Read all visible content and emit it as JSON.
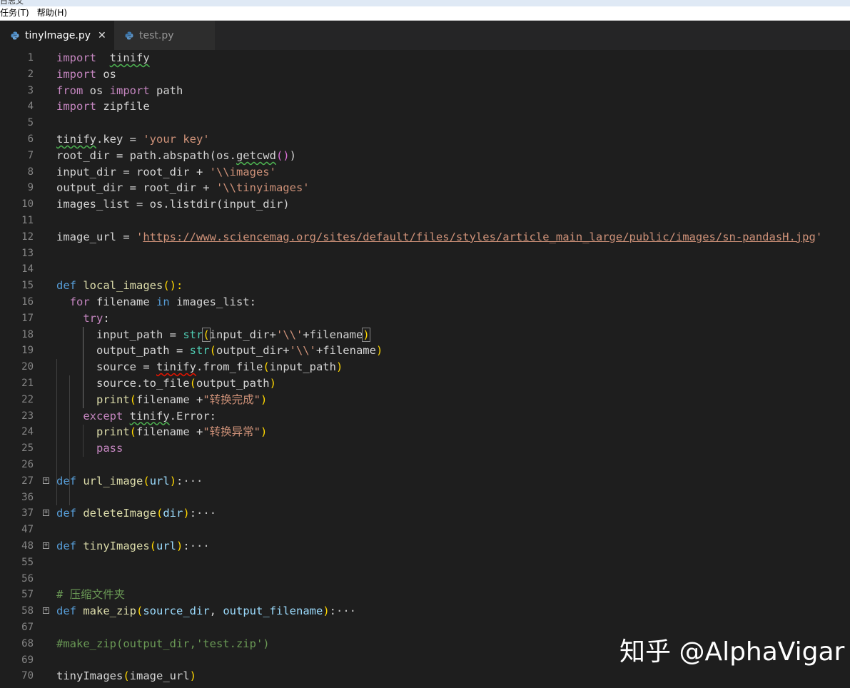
{
  "window": {
    "title_fragment": "日志文"
  },
  "menu": {
    "items": [
      "任务(T)",
      "帮助(H)"
    ]
  },
  "tabs": [
    {
      "label": "tinyImage.py",
      "active": true,
      "close": "✕"
    },
    {
      "label": "test.py",
      "active": false
    }
  ],
  "editor": {
    "lines": [
      {
        "n": "1",
        "tokens": [
          [
            "kw",
            "import"
          ],
          [
            "",
            "  "
          ],
          [
            "sq-green",
            "tinify"
          ]
        ]
      },
      {
        "n": "2",
        "tokens": [
          [
            "kw",
            "import"
          ],
          [
            "",
            " os"
          ]
        ]
      },
      {
        "n": "3",
        "tokens": [
          [
            "kw",
            "from"
          ],
          [
            "",
            " os "
          ],
          [
            "kw",
            "import"
          ],
          [
            "",
            " path"
          ]
        ]
      },
      {
        "n": "4",
        "tokens": [
          [
            "kw",
            "import"
          ],
          [
            "",
            " zipfile"
          ]
        ]
      },
      {
        "n": "5",
        "tokens": []
      },
      {
        "n": "6",
        "tokens": [
          [
            "sq-green",
            "tinify"
          ],
          [
            "",
            ".key = "
          ],
          [
            "str",
            "'your key'"
          ]
        ]
      },
      {
        "n": "7",
        "tokens": [
          [
            "",
            "root_dir = path.abspath(os."
          ],
          [
            "sq-green",
            "getcwd"
          ],
          [
            "br2",
            "()"
          ],
          [
            "",
            ")"
          ]
        ]
      },
      {
        "n": "8",
        "tokens": [
          [
            "",
            "input_dir = root_dir + "
          ],
          [
            "str",
            "'\\\\images'"
          ]
        ]
      },
      {
        "n": "9",
        "tokens": [
          [
            "",
            "output_dir = root_dir + "
          ],
          [
            "str",
            "'\\\\tinyimages'"
          ]
        ]
      },
      {
        "n": "10",
        "tokens": [
          [
            "",
            "images_list = os.listdir(input_dir)"
          ]
        ]
      },
      {
        "n": "11",
        "tokens": []
      },
      {
        "n": "12",
        "tokens": [
          [
            "",
            "image_url = "
          ],
          [
            "str",
            "'"
          ],
          [
            "str link",
            "https://www.sciencemag.org/sites/default/files/styles/article_main_large/public/images/sn-pandasH.jpg"
          ],
          [
            "str",
            "'"
          ]
        ]
      },
      {
        "n": "13",
        "tokens": []
      },
      {
        "n": "14",
        "tokens": []
      },
      {
        "n": "15",
        "tokens": [
          [
            "def",
            "def"
          ],
          [
            "",
            " "
          ],
          [
            "fn",
            "local_images"
          ],
          [
            "br",
            "():"
          ]
        ]
      },
      {
        "n": "16",
        "tokens": [
          [
            "",
            "  "
          ],
          [
            "kw",
            "for"
          ],
          [
            "",
            " filename "
          ],
          [
            "def",
            "in"
          ],
          [
            "",
            " images_list:"
          ]
        ]
      },
      {
        "n": "17",
        "tokens": [
          [
            "",
            "    "
          ],
          [
            "kw",
            "try"
          ],
          [
            "",
            ":"
          ]
        ]
      },
      {
        "n": "18",
        "tokens": [
          [
            "",
            "      input_path = "
          ],
          [
            "bi",
            "str"
          ],
          [
            "br bm",
            "("
          ],
          [
            "",
            "input_dir+"
          ],
          [
            "str",
            "'\\\\'"
          ],
          [
            "",
            "+filename"
          ],
          [
            "br bm",
            ")"
          ]
        ]
      },
      {
        "n": "19",
        "tokens": [
          [
            "",
            "      output_path = "
          ],
          [
            "bi",
            "str"
          ],
          [
            "br",
            "("
          ],
          [
            "",
            "output_dir+"
          ],
          [
            "str",
            "'\\\\'"
          ],
          [
            "",
            "+filename"
          ],
          [
            "br",
            ")"
          ]
        ]
      },
      {
        "n": "20",
        "tokens": [
          [
            "",
            "      source = "
          ],
          [
            "sq-red",
            "tinify"
          ],
          [
            "",
            ".from_file"
          ],
          [
            "br",
            "("
          ],
          [
            "",
            "input_path"
          ],
          [
            "br",
            ")"
          ]
        ]
      },
      {
        "n": "21",
        "tokens": [
          [
            "",
            "      source.to_file"
          ],
          [
            "br",
            "("
          ],
          [
            "",
            "output_path"
          ],
          [
            "br",
            ")"
          ]
        ]
      },
      {
        "n": "22",
        "tokens": [
          [
            "",
            "      "
          ],
          [
            "fn",
            "print"
          ],
          [
            "br",
            "("
          ],
          [
            "",
            "filename +"
          ],
          [
            "str",
            "\"转换完成\""
          ],
          [
            "br",
            ")"
          ]
        ]
      },
      {
        "n": "23",
        "tokens": [
          [
            "",
            "    "
          ],
          [
            "kw",
            "except"
          ],
          [
            "",
            " "
          ],
          [
            "sq-green",
            "tinify"
          ],
          [
            "",
            ".Error:"
          ]
        ]
      },
      {
        "n": "24",
        "tokens": [
          [
            "",
            "      "
          ],
          [
            "fn",
            "print"
          ],
          [
            "br",
            "("
          ],
          [
            "",
            "filename +"
          ],
          [
            "str",
            "\"转换异常\""
          ],
          [
            "br",
            ")"
          ]
        ]
      },
      {
        "n": "25",
        "tokens": [
          [
            "",
            "      "
          ],
          [
            "kw",
            "pass"
          ]
        ]
      },
      {
        "n": "26",
        "tokens": []
      },
      {
        "n": "27",
        "fold": true,
        "tokens": [
          [
            "def",
            "def"
          ],
          [
            "",
            " "
          ],
          [
            "fn",
            "url_image"
          ],
          [
            "br",
            "("
          ],
          [
            "pm",
            "url"
          ],
          [
            "br",
            ")"
          ],
          [
            "",
            ":"
          ],
          [
            "ell",
            "···"
          ]
        ]
      },
      {
        "n": "36",
        "tokens": []
      },
      {
        "n": "37",
        "fold": true,
        "tokens": [
          [
            "def",
            "def"
          ],
          [
            "",
            " "
          ],
          [
            "fn",
            "deleteImage"
          ],
          [
            "br",
            "("
          ],
          [
            "pm",
            "dir"
          ],
          [
            "br",
            ")"
          ],
          [
            "",
            ":"
          ],
          [
            "ell",
            "···"
          ]
        ]
      },
      {
        "n": "47",
        "tokens": []
      },
      {
        "n": "48",
        "fold": true,
        "tokens": [
          [
            "def",
            "def"
          ],
          [
            "",
            " "
          ],
          [
            "fn",
            "tinyImages"
          ],
          [
            "br",
            "("
          ],
          [
            "pm",
            "url"
          ],
          [
            "br",
            ")"
          ],
          [
            "",
            ":"
          ],
          [
            "ell",
            "···"
          ]
        ]
      },
      {
        "n": "55",
        "tokens": []
      },
      {
        "n": "56",
        "tokens": []
      },
      {
        "n": "57",
        "tokens": [
          [
            "cmt",
            "# 压缩文件夹"
          ]
        ]
      },
      {
        "n": "58",
        "fold": true,
        "tokens": [
          [
            "def",
            "def"
          ],
          [
            "",
            " "
          ],
          [
            "fn",
            "make_zip"
          ],
          [
            "br",
            "("
          ],
          [
            "pm",
            "source_dir"
          ],
          [
            "",
            ", "
          ],
          [
            "pm",
            "output_filename"
          ],
          [
            "br",
            ")"
          ],
          [
            "",
            ":"
          ],
          [
            "ell",
            "···"
          ]
        ]
      },
      {
        "n": "67",
        "tokens": []
      },
      {
        "n": "68",
        "tokens": [
          [
            "cmt",
            "#make_zip(output_dir,'test.zip')"
          ]
        ]
      },
      {
        "n": "69",
        "tokens": []
      },
      {
        "n": "70",
        "tokens": [
          [
            "",
            "tinyImages"
          ],
          [
            "br",
            "("
          ],
          [
            "",
            "image_url"
          ],
          [
            "br",
            ")"
          ]
        ]
      }
    ]
  },
  "watermark": {
    "text": "知乎 @AlphaVigar"
  },
  "colors": {
    "background": "#1e1e1e",
    "keyword": "#c586c0",
    "storage": "#569cd6",
    "function": "#dcdcaa",
    "string": "#ce9178",
    "comment": "#6a9955",
    "bracket": "#ffd700"
  }
}
